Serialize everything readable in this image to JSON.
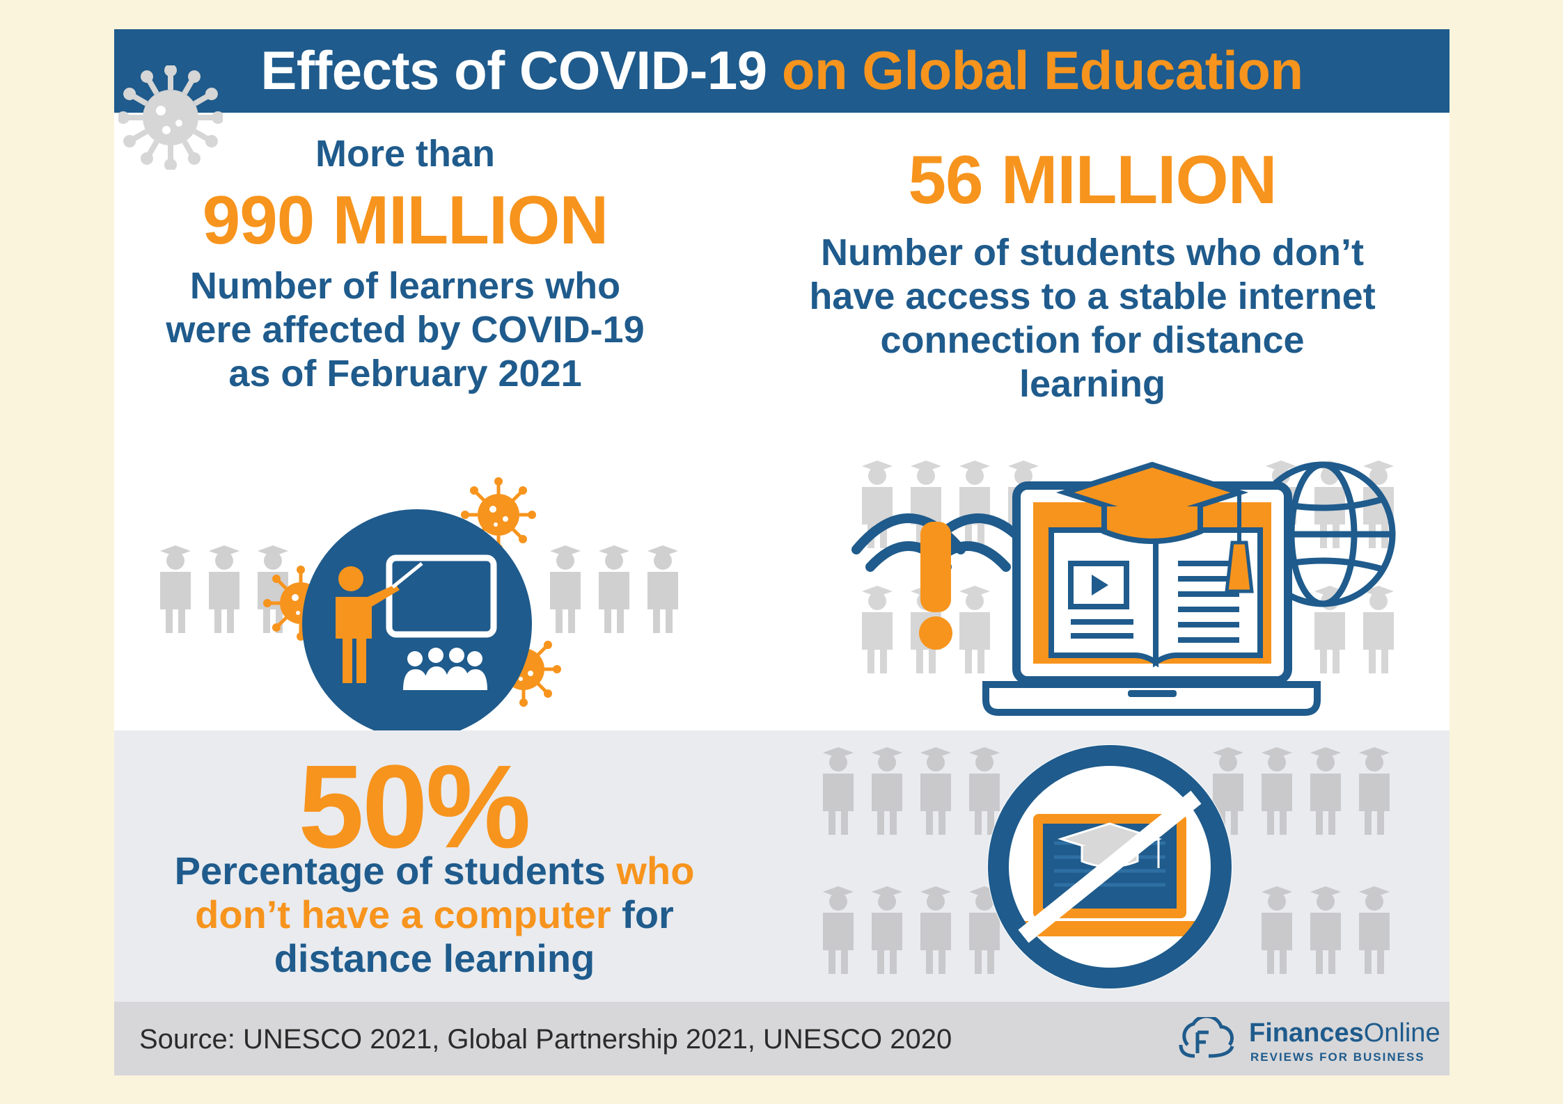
{
  "header": {
    "title_part1": "Effects of COVID-19",
    "title_part2": "on Global Education"
  },
  "stat_learners": {
    "prefix": "More than",
    "value": "990 MILLION",
    "description": "Number of learners who were affected by COVID-19 as of February 2021"
  },
  "stat_internet": {
    "value": "56 MILLION",
    "description": "Number of students who don’t have access to a stable internet connection for distance learning"
  },
  "stat_computer": {
    "value": "50%",
    "description_part1": "Percentage of students",
    "description_part2": "who don’t have a computer",
    "description_part3": "for distance learning"
  },
  "footer": {
    "source": "Source: UNESCO 2021, Global Partnership 2021, UNESCO 2020",
    "logo_name_bold": "Finances",
    "logo_name_light": "Online",
    "logo_tagline": "REVIEWS FOR BUSINESS"
  },
  "colors": {
    "navy": "#1f5b8c",
    "orange": "#f7941d",
    "gray": "#cccccc",
    "background": "#fbf4dc"
  },
  "icons": [
    "virus-icon",
    "teacher-classroom-icon",
    "graduate-silhouette-icon",
    "wifi-warning-icon",
    "laptop-graduation-icon",
    "globe-icon",
    "no-computer-icon",
    "financesonline-logo-icon"
  ]
}
